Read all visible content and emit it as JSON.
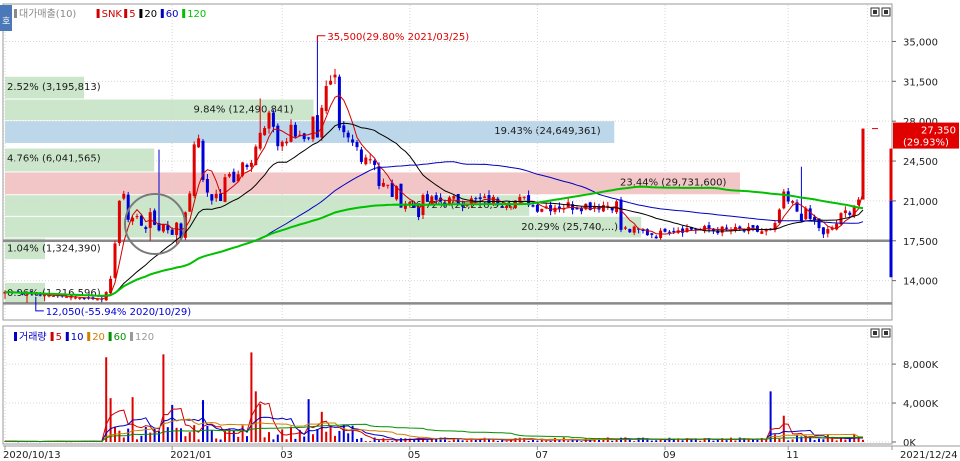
{
  "price_panel": {
    "legend": [
      {
        "text": "대가매출(10)",
        "color": "#8a8a8a"
      },
      {
        "text": "SNK",
        "color": "#d00000"
      },
      {
        "text": "5",
        "color": "#d00000"
      },
      {
        "text": "20",
        "color": "#000000"
      },
      {
        "text": "60",
        "color": "#0000c0"
      },
      {
        "text": "120",
        "color": "#00c000"
      }
    ],
    "corner_badge": "호"
  },
  "volume_panel": {
    "legend": [
      {
        "text": "거래량",
        "color": "#0000c0"
      },
      {
        "text": "5",
        "color": "#d00000"
      },
      {
        "text": "10",
        "color": "#0000c0"
      },
      {
        "text": "20",
        "color": "#d08000"
      },
      {
        "text": "60",
        "color": "#009000"
      },
      {
        "text": "120",
        "color": "#9a9a9a"
      }
    ]
  },
  "chart_data": [
    {
      "type": "candlestick",
      "name": "price",
      "y_ticks": [
        14000,
        17500,
        21000,
        24500,
        28000,
        31500,
        35000
      ],
      "y_tick_labels": [
        "14,000",
        "17,500",
        "21,000",
        "24,500",
        "28,000",
        "31,500",
        "35,000"
      ],
      "x_labels": [
        "2020/10/13",
        "2021/01",
        "03",
        "05",
        "07",
        "09",
        "11",
        "2021/12/24"
      ],
      "last_price": {
        "value": 27350,
        "label": "27,350",
        "change": "(29.93%)"
      },
      "annotations": {
        "high": {
          "value": 35500,
          "label": "35,500(29.80% 2021/03/25)"
        },
        "low": {
          "value": 12050,
          "label": "12,050(-55.94% 2020/10/29)"
        }
      },
      "volume_profile": [
        {
          "low": 26000,
          "high": 28000,
          "label": "19.43% (24,649,361)",
          "color": "#bcd7ea"
        },
        {
          "low": 21500,
          "high": 23500,
          "label": "23.44% (29,731,600)",
          "color": "#f2c6c6"
        },
        {
          "low": 19600,
          "high": 21500,
          "label": "16.72% (21,216,914)",
          "color": "#cbe6cb"
        },
        {
          "low": 17700,
          "high": 19600,
          "label": "20.29% (25,740,...)",
          "color": "#cbe6cb"
        },
        {
          "low": 23500,
          "high": 25600,
          "label": "4.76% (6,041,565)",
          "color": "#cbe6cb"
        },
        {
          "low": 28000,
          "high": 29900,
          "label": "9.84% (12,490,841)",
          "color": "#cbe6cb"
        },
        {
          "low": 29900,
          "high": 31900,
          "label": "2.52% (3,195,813)",
          "color": "#cbe6cb"
        },
        {
          "low": 15800,
          "high": 17700,
          "label": "1.04% (1,324,390)",
          "color": "#cbe6cb"
        },
        {
          "low": 11900,
          "high": 13800,
          "label": "0.96% (1,216,596)",
          "color": "#cbe6cb"
        }
      ],
      "horizontal_lines": [
        17500,
        12000
      ],
      "segments": [
        {
          "t0": 0,
          "t1": 23,
          "p0": 13000,
          "p1": 12300,
          "vol": 0.0
        },
        {
          "t0": 23,
          "t1": 28,
          "p0": 12300,
          "p1": 25000,
          "vol": 0.06
        },
        {
          "t0": 28,
          "t1": 40,
          "p0": 19500,
          "p1": 18500,
          "vol": 0.05
        },
        {
          "t0": 40,
          "t1": 45,
          "p0": 18000,
          "p1": 29500,
          "vol": 0.05
        },
        {
          "t0": 45,
          "t1": 50,
          "p0": 22000,
          "p1": 21000,
          "vol": 0.05
        },
        {
          "t0": 50,
          "t1": 62,
          "p0": 22500,
          "p1": 28500,
          "vol": 0.05
        },
        {
          "t0": 62,
          "t1": 72,
          "p0": 26000,
          "p1": 28000,
          "vol": 0.06
        },
        {
          "t0": 72,
          "t1": 76,
          "p0": 30000,
          "p1": 30500,
          "vol": 0.06
        },
        {
          "t0": 76,
          "t1": 85,
          "p0": 26500,
          "p1": 24500,
          "vol": 0.04
        },
        {
          "t0": 85,
          "t1": 95,
          "p0": 22500,
          "p1": 20000,
          "vol": 0.04
        },
        {
          "t0": 95,
          "t1": 120,
          "p0": 21000,
          "p1": 21000,
          "vol": 0.025
        },
        {
          "t0": 120,
          "t1": 140,
          "p0": 20500,
          "p1": 20700,
          "vol": 0.025
        },
        {
          "t0": 140,
          "t1": 150,
          "p0": 18500,
          "p1": 18000,
          "vol": 0.025
        },
        {
          "t0": 150,
          "t1": 175,
          "p0": 18600,
          "p1": 18300,
          "vol": 0.02
        },
        {
          "t0": 175,
          "t1": 177,
          "p0": 18300,
          "p1": 22000,
          "vol": 0.05
        },
        {
          "t0": 177,
          "t1": 186,
          "p0": 21000,
          "p1": 18500,
          "vol": 0.04
        },
        {
          "t0": 186,
          "t1": 196,
          "p0": 17800,
          "p1": 22000,
          "vol": 0.03
        }
      ],
      "spikes": {
        "35": 25500,
        "58": 30000,
        "71": 35500,
        "181": 24000
      },
      "lows": {
        "0": 12400,
        "5": 12050,
        "9": 12200,
        "33": 17500,
        "39": 17200
      },
      "ma_series": [
        {
          "name": "5",
          "color": "#d00000"
        },
        {
          "name": "20",
          "color": "#000000"
        },
        {
          "name": "60",
          "color": "#0000c0"
        },
        {
          "name": "120",
          "color": "#00c000"
        }
      ]
    },
    {
      "type": "bar",
      "name": "volume",
      "y_ticks": [
        0,
        4000,
        8000
      ],
      "y_tick_labels": [
        "0K",
        "4,000K",
        "8,000K"
      ],
      "ylim": [
        0,
        11500
      ],
      "peaks": {
        "23": 8700,
        "24": 4500,
        "29": 4600,
        "36": 9000,
        "38": 3800,
        "45": 4300,
        "56": 9200,
        "57": 5200,
        "58": 3900,
        "69": 4400,
        "72": 3100,
        "174": 5200,
        "177": 2700
      }
    }
  ]
}
